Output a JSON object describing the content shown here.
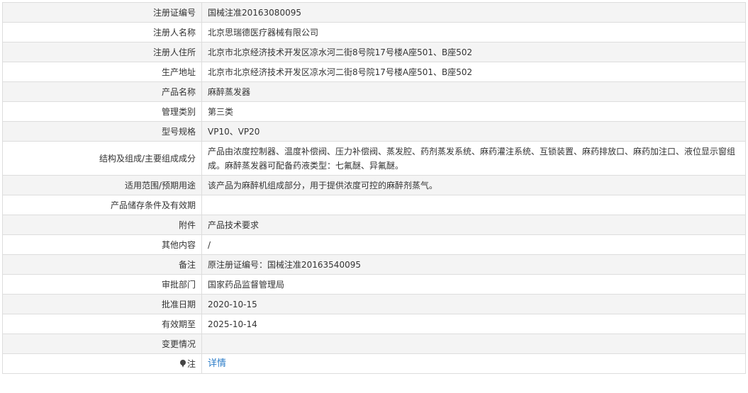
{
  "rows": [
    {
      "label": "注册证编号",
      "value": "国械注准20163080095"
    },
    {
      "label": "注册人名称",
      "value": "北京思瑞德医疗器械有限公司"
    },
    {
      "label": "注册人住所",
      "value": "北京市北京经济技术开发区凉水河二街8号院17号楼A座501、B座502"
    },
    {
      "label": "生产地址",
      "value": "北京市北京经济技术开发区凉水河二街8号院17号楼A座501、B座502"
    },
    {
      "label": "产品名称",
      "value": "麻醉蒸发器"
    },
    {
      "label": "管理类别",
      "value": "第三类"
    },
    {
      "label": "型号规格",
      "value": "VP10、VP20"
    },
    {
      "label": "结构及组成/主要组成成分",
      "value": "产品由浓度控制器、温度补偿阀、压力补偿阀、蒸发腔、药剂蒸发系统、麻药灌注系统、互锁装置、麻药排放口、麻药加注口、液位显示窗组成。麻醉蒸发器可配备药液类型：七氟醚、异氟醚。"
    },
    {
      "label": "适用范围/预期用途",
      "value": "该产品为麻醉机组成部分，用于提供浓度可控的麻醉剂蒸气。"
    },
    {
      "label": "产品储存条件及有效期",
      "value": ""
    },
    {
      "label": "附件",
      "value": "产品技术要求"
    },
    {
      "label": "其他内容",
      "value": "/"
    },
    {
      "label": "备注",
      "value": "原注册证编号：国械注准20163540095"
    },
    {
      "label": "审批部门",
      "value": "国家药品监督管理局"
    },
    {
      "label": "批准日期",
      "value": "2020-10-15"
    },
    {
      "label": "有效期至",
      "value": "2025-10-14"
    },
    {
      "label": "变更情况",
      "value": ""
    }
  ],
  "note": {
    "label": "注",
    "icon": "map-pin-icon",
    "link_text": "详情",
    "link_color": "#2d7dc8"
  }
}
